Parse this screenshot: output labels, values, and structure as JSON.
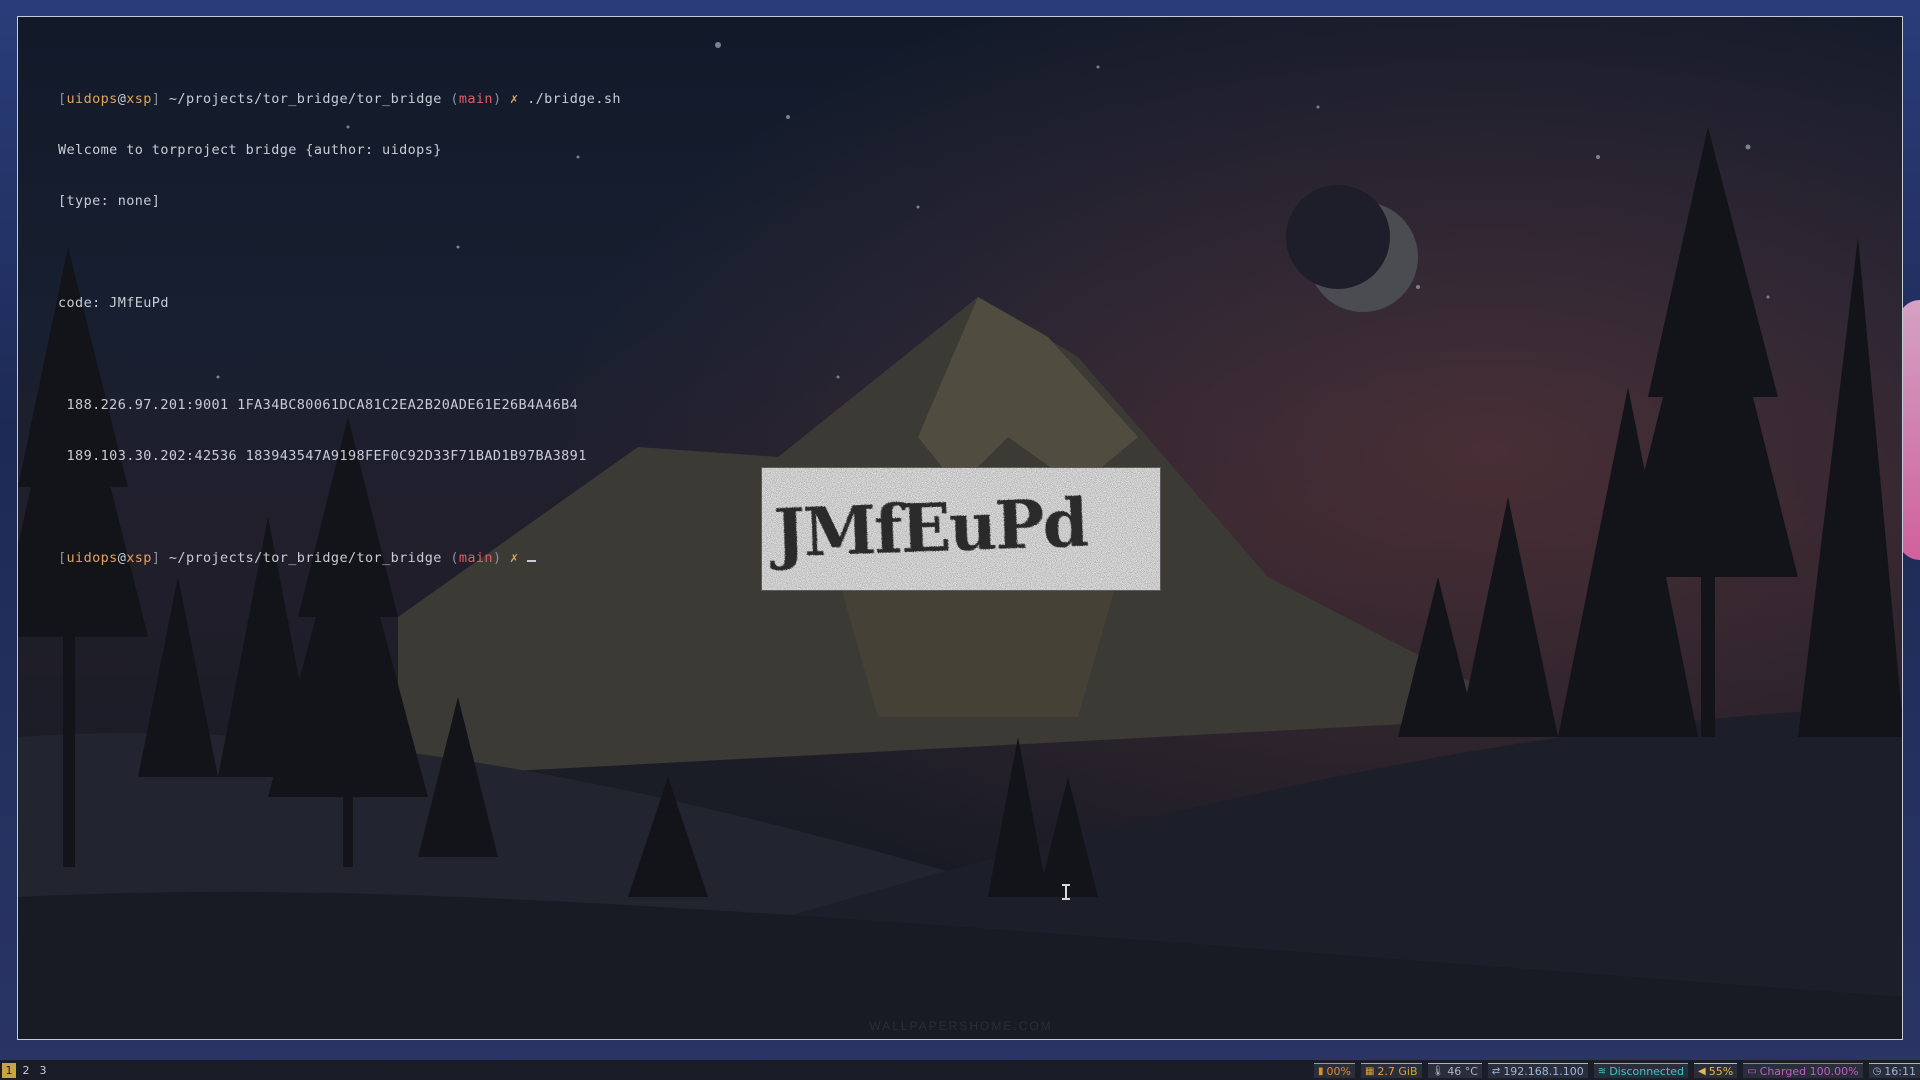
{
  "terminal": {
    "prompt1": {
      "user": "uidops",
      "host": "xsp",
      "path": "~/projects/tor_bridge/tor_bridge",
      "branch": "main",
      "symbol": "✗",
      "command": "./bridge.sh"
    },
    "output": {
      "welcome": "Welcome to torproject bridge {author: uidops}",
      "type": "[type: none]",
      "code": "code: JMfEuPd",
      "bridges": [
        " 188.226.97.201:9001 1FA34BC80061DCA81C2EA2B20ADE61E26B4A46B4",
        " 189.103.30.202:42536 183943547A9198FEF0C92D33F71BAD1B97BA3891"
      ]
    },
    "prompt2": {
      "user": "uidops",
      "host": "xsp",
      "path": "~/projects/tor_bridge/tor_bridge",
      "branch": "main",
      "symbol": "✗"
    }
  },
  "captcha": {
    "text": "JMfEuPd"
  },
  "wallpaper": {
    "watermark": "WALLPAPERSHOME.COM"
  },
  "statusbar": {
    "workspaces": [
      "1",
      "2",
      "3"
    ],
    "active_workspace": "1",
    "modules": [
      {
        "icon": "cpu-icon",
        "glyph": "▮",
        "label": "00%",
        "color": "#e08a2c"
      },
      {
        "icon": "memory-icon",
        "glyph": "▦",
        "label": "2.7 GiB",
        "color": "#e0a02c"
      },
      {
        "icon": "thermometer-icon",
        "glyph": "🌡",
        "label": "46 °C",
        "color": "#b0b4bd"
      },
      {
        "icon": "ethernet-icon",
        "glyph": "⇄",
        "label": "192.168.1.100",
        "color": "#9fb7d9"
      },
      {
        "icon": "wifi-icon",
        "glyph": "≋",
        "label": "Disconnected",
        "color": "#3ec6c6"
      },
      {
        "icon": "volume-icon",
        "glyph": "◀",
        "label": "55%",
        "color": "#e8b84a"
      },
      {
        "icon": "battery-icon",
        "glyph": "▭",
        "label": "Charged 100.00%",
        "color": "#c05cc9"
      },
      {
        "icon": "clock-icon",
        "glyph": "◷",
        "label": "16:11",
        "color": "#9fb7d9"
      }
    ]
  }
}
